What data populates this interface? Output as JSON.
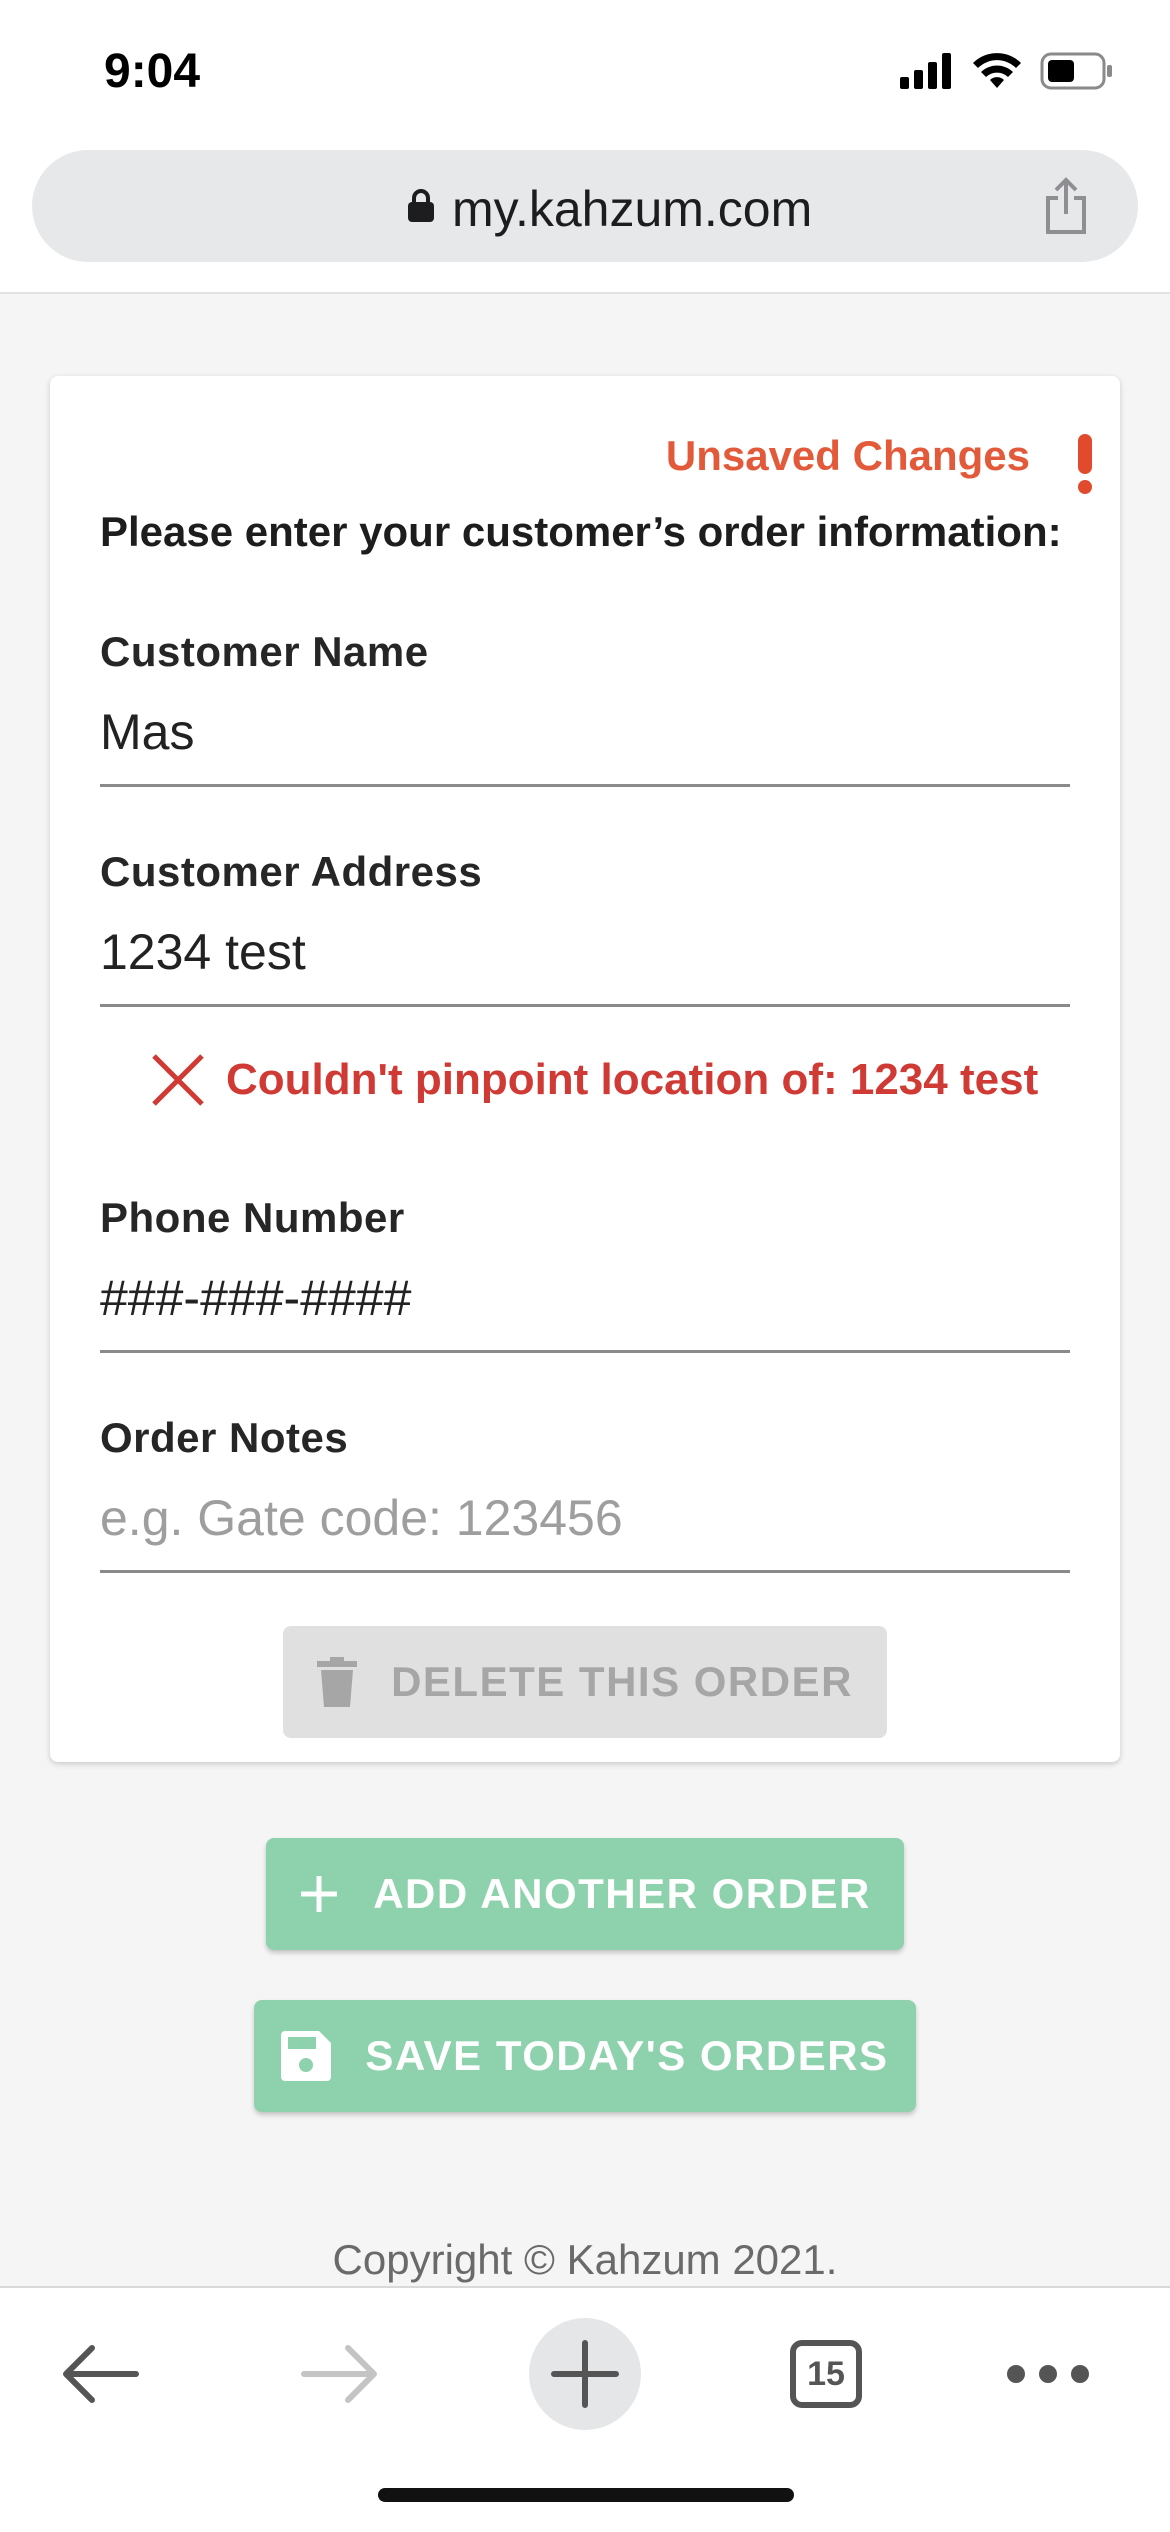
{
  "status_bar": {
    "time": "9:04"
  },
  "browser": {
    "url": "my.kahzum.com",
    "tab_count": "15"
  },
  "form": {
    "unsaved_notice": "Unsaved Changes",
    "instructions": "Please enter your customer’s order information:",
    "customer_name": {
      "label": "Customer Name",
      "value": "Mas"
    },
    "customer_address": {
      "label": "Customer Address",
      "value": "1234 test"
    },
    "address_error": "Couldn't pinpoint location of: 1234 test",
    "phone_number": {
      "label": "Phone Number",
      "value": "###-###-####"
    },
    "order_notes": {
      "label": "Order Notes",
      "placeholder": "e.g. Gate code: 123456"
    },
    "delete_button": "DELETE THIS ORDER"
  },
  "actions": {
    "add_order": "ADD ANOTHER ORDER",
    "save_orders": "SAVE TODAY'S ORDERS"
  },
  "footer": {
    "copyright": "Copyright © Kahzum 2021."
  },
  "colors": {
    "accent_green": "#8dd2ad",
    "error_red": "#d03a35",
    "warning_orange": "#e25a3a"
  },
  "icons": {
    "toolbar": [
      "back-arrow-icon",
      "forward-arrow-icon",
      "new-tab-plus-icon",
      "tab-count-icon",
      "more-icon"
    ]
  }
}
